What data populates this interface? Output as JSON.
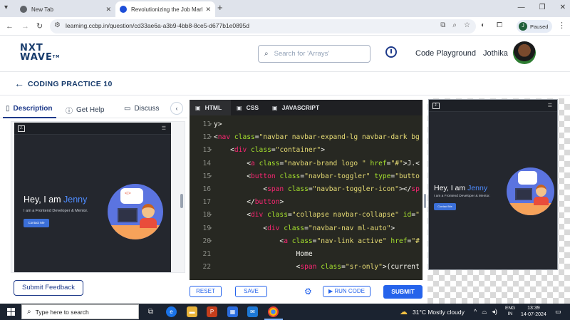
{
  "browser": {
    "tabs": [
      {
        "title": "New Tab"
      },
      {
        "title": "Revolutionizing the Job Market"
      }
    ],
    "url": "learning.ccbp.in/question/cd33ae6a-a3b9-4bb8-8ce5-d677b1e0895d",
    "profile_initial": "J",
    "profile_status": "Paused"
  },
  "header": {
    "logo_line1": "NXT",
    "logo_line2": "WAVE",
    "logo_tm": "TM",
    "search_placeholder": "Search for 'Arrays'",
    "code_playground": "Code Playground",
    "user_name": "Jothika"
  },
  "practice": {
    "title": "CODING PRACTICE 10"
  },
  "left_panel": {
    "tabs": [
      {
        "label": "Description"
      },
      {
        "label": "Get Help"
      },
      {
        "label": "Discuss"
      }
    ],
    "submit_feedback": "Submit Feedback"
  },
  "preview": {
    "brand_initial": "J.",
    "hero_greeting": "Hey, I am ",
    "hero_name": "Jenny",
    "hero_subtitle": "I am a Frontend Developer & Mentor.",
    "hero_button": "Contact Me"
  },
  "editor": {
    "tabs": [
      {
        "label": "HTML"
      },
      {
        "label": "CSS"
      },
      {
        "label": "JAVASCRIPT"
      }
    ],
    "lines": [
      {
        "n": "11",
        "fold": true,
        "code": "y>"
      },
      {
        "n": "12",
        "fold": true,
        "code": "<nav class=\"navbar navbar-expand-lg navbar-dark bg"
      },
      {
        "n": "13",
        "fold": true,
        "code": "    <div class=\"container\">"
      },
      {
        "n": "14",
        "fold": false,
        "code": "        <a class=\"navbar-brand logo \" href=\"#\">J.<"
      },
      {
        "n": "15",
        "fold": true,
        "code": "        <button class=\"navbar-toggler\" type=\"butto"
      },
      {
        "n": "16",
        "fold": false,
        "code": "            <span class=\"navbar-toggler-icon\"></sp"
      },
      {
        "n": "17",
        "fold": false,
        "code": "        </button>"
      },
      {
        "n": "18",
        "fold": true,
        "code": "        <div class=\"collapse navbar-collapse\" id=\""
      },
      {
        "n": "19",
        "fold": true,
        "code": "            <div class=\"navbar-nav ml-auto\">"
      },
      {
        "n": "20",
        "fold": true,
        "code": "                <a class=\"nav-link active\" href=\"#"
      },
      {
        "n": "21",
        "fold": false,
        "code": "                    Home"
      },
      {
        "n": "22",
        "fold": false,
        "code": "                    <span class=\"sr-only\">(current"
      }
    ]
  },
  "actions": {
    "reset": "RESET",
    "save": "SAVE",
    "run_code": "RUN CODE",
    "submit": "SUBMIT"
  },
  "taskbar": {
    "search_placeholder": "Type here to search",
    "weather": "31°C  Mostly cloudy",
    "lang_line1": "ENG",
    "lang_line2": "IN",
    "time": "13:39",
    "date": "14-07-2024"
  },
  "colors": {
    "brand_navy": "#173b6c",
    "primary_blue": "#2563eb",
    "editor_bg": "#272822",
    "preview_bg": "#24272e",
    "accent_name": "#4e8cff"
  }
}
